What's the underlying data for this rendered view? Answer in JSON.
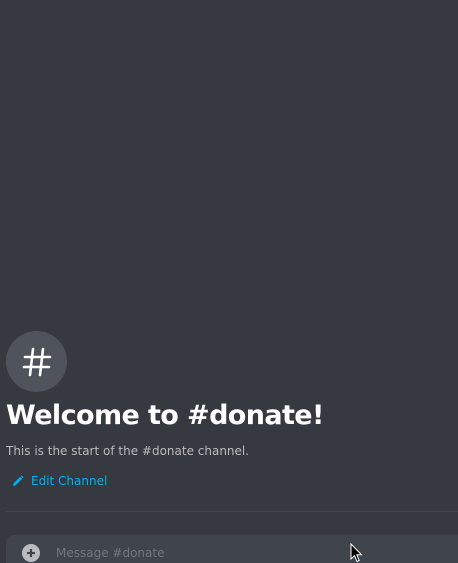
{
  "channel": {
    "icon": "hash-icon",
    "welcome_title": "Welcome to #donate!",
    "description": "This is the start of the #donate channel.",
    "edit_label": "Edit Channel",
    "edit_icon": "pencil-icon"
  },
  "composer": {
    "upload_icon": "plus-circle-icon",
    "placeholder": "Message #donate"
  },
  "colors": {
    "background": "#36393f",
    "icon_circle": "#4f545c",
    "title": "#ffffff",
    "description": "#b9bbbe",
    "link": "#00b0f4",
    "composer": "#40444b",
    "placeholder": "#72767d"
  }
}
